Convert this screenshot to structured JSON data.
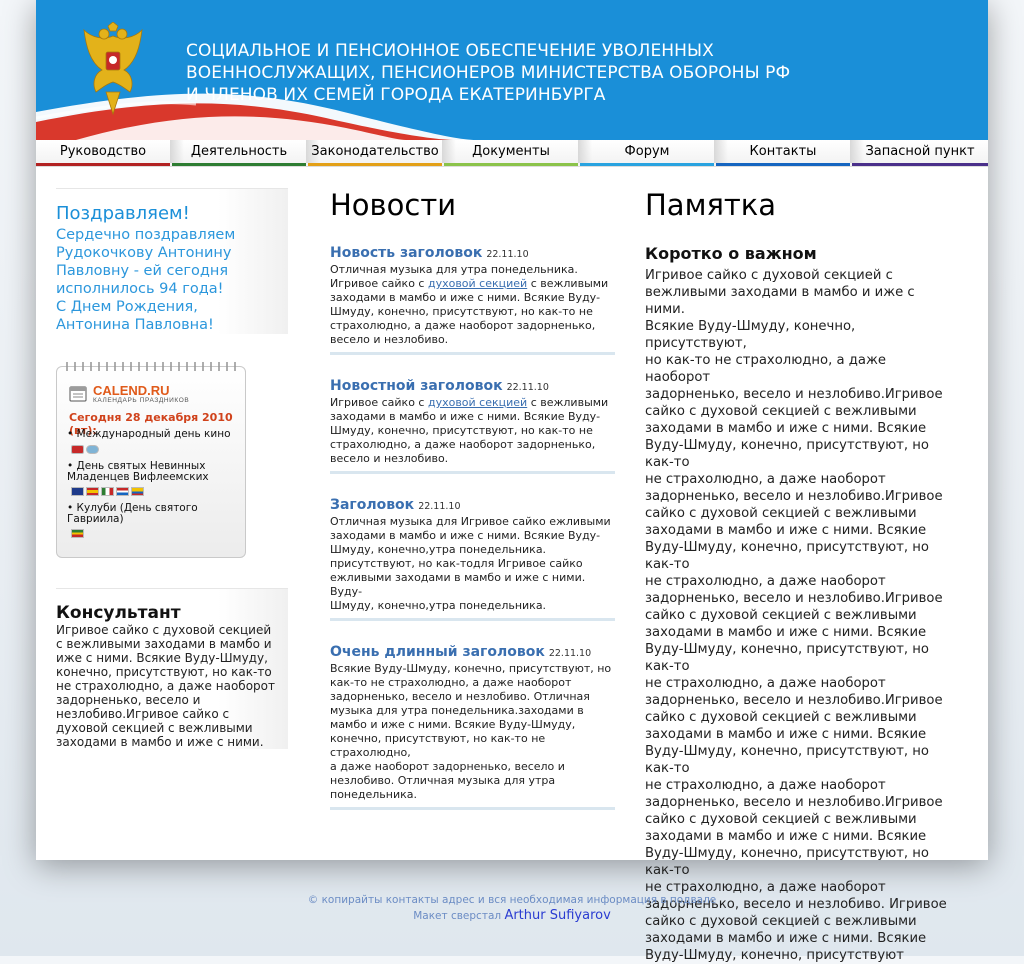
{
  "header": {
    "title_lines": [
      "СОЦИАЛЬНОЕ И ПЕНСИОННОЕ ОБЕСПЕЧЕНИЕ УВОЛЕННЫХ",
      "ВОЕННОСЛУЖАЩИХ, ПЕНСИОНЕРОВ МИНИСТЕРСТВА ОБОРОНЫ РФ",
      "И ЧЛЕНОВ ИХ СЕМЕЙ ГОРОДА ЕКАТЕРИНБУРГА"
    ],
    "logo_icon": "coat-of-arms-icon",
    "bg_color": "#1a8fd8"
  },
  "menu": {
    "items": [
      {
        "label": "Руководство",
        "color": "#b22222"
      },
      {
        "label": "Деятельность",
        "color": "#2e7d32"
      },
      {
        "label": "Законодательство",
        "color": "#e3a017"
      },
      {
        "label": "Документы",
        "color": "#8bc34a"
      },
      {
        "label": "Форум",
        "color": "#29a3e0"
      },
      {
        "label": "Контакты",
        "color": "#1565c0"
      },
      {
        "label": "Запасной пункт",
        "color": "#4a2f8a"
      }
    ]
  },
  "congrats": {
    "title": "Поздравляем!",
    "lines": [
      "Сердечно поздравляем",
      "Рудокочкову Антонину",
      "Павловну - ей сегодня",
      "исполнилось 94 года!",
      "С Днем Рождения,",
      "Антонина Павловна!"
    ]
  },
  "calendar": {
    "logo": "CALEND.RU",
    "logo_sub": "КАЛЕНДАРЬ ПРАЗДНИКОВ",
    "today": "Сегодня 28 декабря 2010 (вт):",
    "events": [
      {
        "lines": [
          "• Международный день кино"
        ],
        "flags": [
          "#c62828",
          "#7fb3d5"
        ]
      },
      {
        "lines": [
          "• День святых Невинных",
          "Младенцев Вифлеемских"
        ],
        "flags": [
          "#1e3a8a",
          "#f2c200",
          "#2e7d32",
          "#1565c0",
          "#455a64"
        ]
      },
      {
        "lines": [
          "• Кулуби (День святого",
          "Гавриила)"
        ],
        "flags": [
          "#2e7d32"
        ]
      }
    ]
  },
  "consult": {
    "title": "Консультант",
    "lines": [
      "Игривое сайко с духовой секцией",
      "с вежливыми заходами в мамбо и",
      "иже с ними. Всякие Вуду-Шмуду,",
      "конечно, присутствуют, но как-то",
      "не страхолюдно, а даже наоборот",
      "задорненько, весело и",
      "незлобиво.Игривое сайко с",
      "духовой секцией с вежливыми",
      "заходами в мамбо и иже с ними."
    ]
  },
  "news": {
    "heading": "Новости",
    "items": [
      {
        "title": "Новость заголовок",
        "date": "22.11.10",
        "lines": [
          "Отличная музыка для утра понедельника.",
          "Игривое сайко с |духовой секцией| с вежливыми",
          "заходами в мамбо и иже с ними. Всякие Вуду-",
          "Шмуду, конечно, присутствуют, но как-то не",
          "страхолюдно, а даже наоборот задорненько,",
          "весело и незлобиво."
        ]
      },
      {
        "title": "Новостной заголовок",
        "date": "22.11.10",
        "lines": [
          "Игривое сайко с |духовой секцией| с вежливыми",
          "заходами в мамбо и иже с ними. Всякие Вуду-",
          "Шмуду, конечно, присутствуют, но как-то не",
          "страхолюдно, а даже наоборот задорненько,",
          "весело и незлобиво."
        ]
      },
      {
        "title": "Заголовок",
        "date": "22.11.10",
        "lines": [
          "Отличная музыка для Игривое сайко ежливыми",
          "заходами в мамбо и иже с ними. Всякие Вуду-",
          "Шмуду, конечно,утра понедельника.",
          "присутствуют, но как-тодля Игривое сайко",
          "ежливыми заходами в мамбо и иже с ними. Вуду-",
          "Шмуду, конечно,утра понедельника."
        ]
      },
      {
        "title": "Очень длинный заголовок",
        "date": "22.11.10",
        "lines": [
          "Всякие Вуду-Шмуду, конечно, присутствуют, но",
          "как-то не страхолюдно, а даже наоборот",
          "задорненько, весело и незлобиво. Отличная",
          "музыка для утра понедельника.заходами в",
          "мамбо и иже с ними. Всякие Вуду-Шмуду,",
          "конечно, присутствуют, но как-то не страхолюдно,",
          "а даже наоборот задорненько, весело и",
          "незлобиво. Отличная музыка для утра",
          "понедельника."
        ]
      }
    ]
  },
  "memo": {
    "heading": "Памятка",
    "subheading": "Коротко о важном",
    "lines": [
      "Игривое сайко с духовой секцией с",
      "вежливыми заходами в мамбо и иже с ними.",
      "Всякие Вуду-Шмуду, конечно, присутствуют,",
      "но как-то не страхолюдно, а даже наоборот",
      "задорненько, весело и незлобиво.Игривое",
      "сайко с духовой секцией с вежливыми",
      "заходами в мамбо и иже с ними. Всякие",
      "Вуду-Шмуду, конечно, присутствуют, но как-то",
      "не страхолюдно, а даже наоборот",
      "задорненько, весело и незлобиво.Игривое",
      "сайко с духовой секцией с вежливыми",
      "заходами в мамбо и иже с ними. Всякие",
      "Вуду-Шмуду, конечно, присутствуют, но как-то",
      "не страхолюдно, а даже наоборот",
      "задорненько, весело и незлобиво.Игривое",
      "сайко с духовой секцией с вежливыми",
      "заходами в мамбо и иже с ними. Всякие",
      "Вуду-Шмуду, конечно, присутствуют, но как-то",
      "не страхолюдно, а даже наоборот",
      "задорненько, весело и незлобиво.Игривое",
      "сайко с духовой секцией с вежливыми",
      "заходами в мамбо и иже с ними. Всякие",
      "Вуду-Шмуду, конечно, присутствуют, но как-то",
      "не страхолюдно, а даже наоборот",
      "задорненько, весело и незлобиво.Игривое",
      "сайко с духовой секцией с вежливыми",
      "заходами в мамбо и иже с ними. Всякие",
      "Вуду-Шмуду, конечно, присутствуют, но как-то",
      "не страхолюдно, а даже наоборот",
      "задорненько, весело и незлобиво. Игривое",
      "сайко с духовой секцией с вежливыми",
      "заходами в мамбо и иже с ними. Всякие",
      "Вуду-Шмуду, конечно, присутствуют"
    ]
  },
  "footer": {
    "copyright": "© копирайты контакты адрес и вся необходимая информация в подвале",
    "credit_prefix": "Макет сверстал",
    "credit_name": "Arthur Sufiyarov"
  }
}
